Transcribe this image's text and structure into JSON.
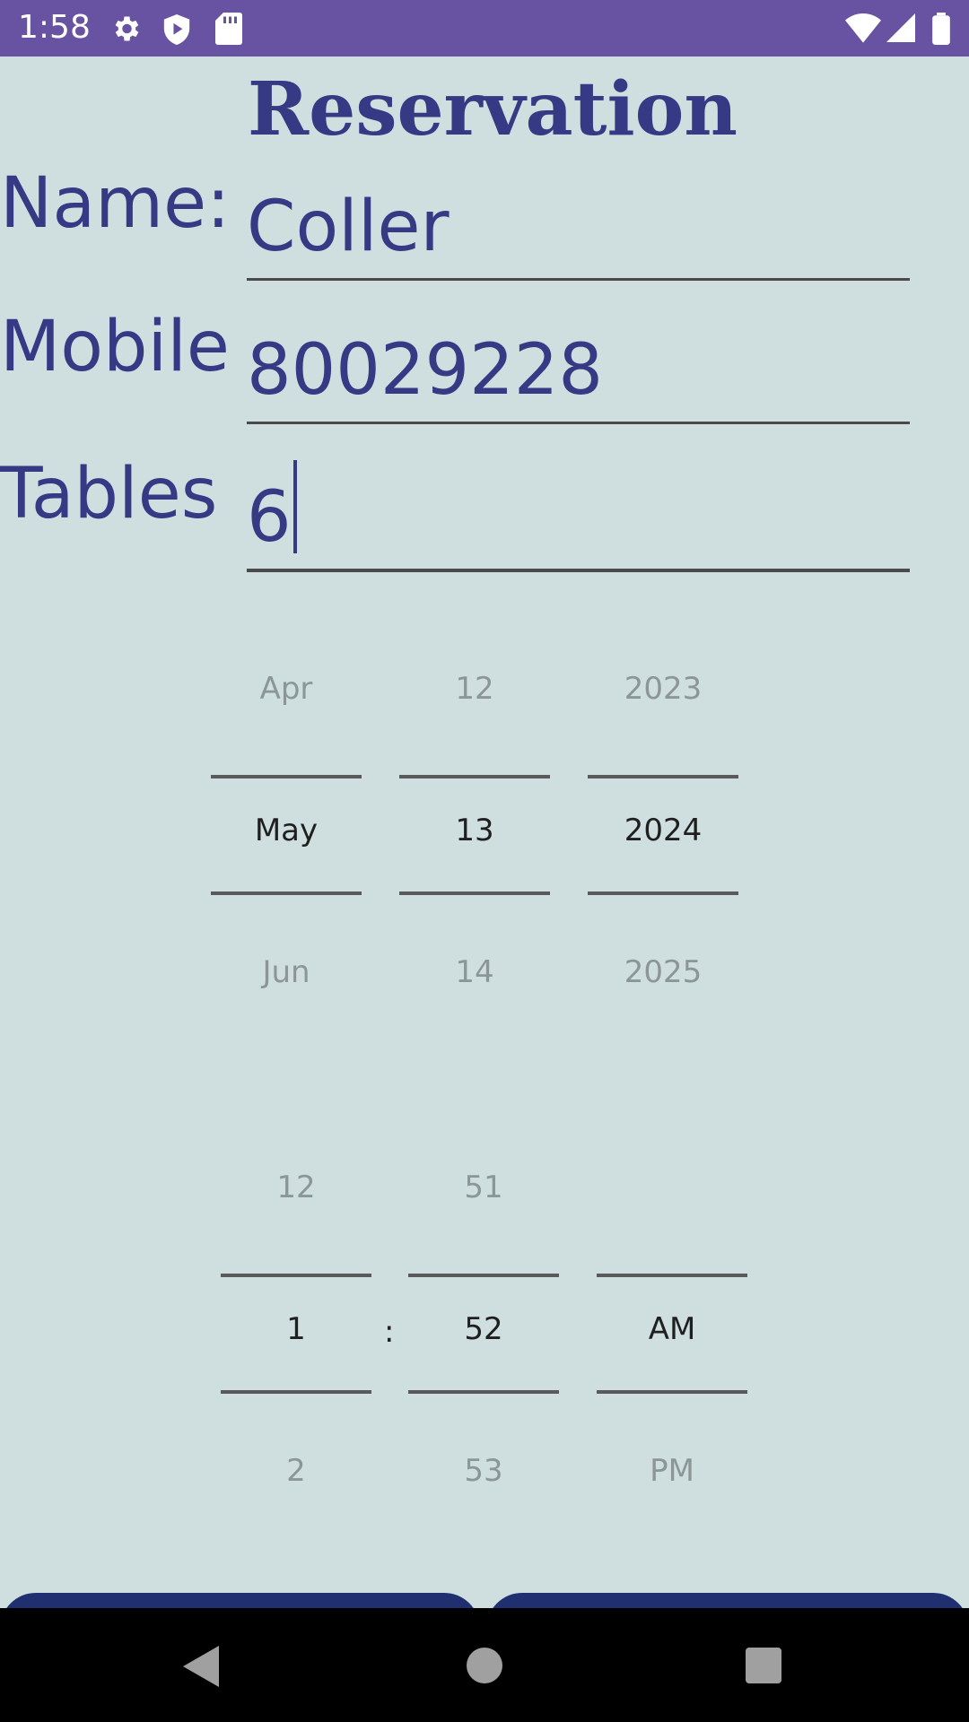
{
  "status_bar": {
    "time": "1:58",
    "icons": [
      "settings-icon",
      "shield-play-icon",
      "sd-card-icon",
      "wifi-icon",
      "signal-icon",
      "battery-icon"
    ]
  },
  "title": "Reservation",
  "form": {
    "name_label": "Name:",
    "name_value": "Coller",
    "mobile_label": "Mobile",
    "mobile_value": "80029228",
    "tables_label": "Tables",
    "tables_value": "6"
  },
  "date_picker": {
    "month": {
      "prev": "Apr",
      "selected": "May",
      "next": "Jun"
    },
    "day": {
      "prev": "12",
      "selected": "13",
      "next": "14"
    },
    "year": {
      "prev": "2023",
      "selected": "2024",
      "next": "2025"
    }
  },
  "time_picker": {
    "hour": {
      "prev": "12",
      "selected": "1",
      "next": "2"
    },
    "separator": ":",
    "minute": {
      "prev": "51",
      "selected": "52",
      "next": "53"
    },
    "ampm": {
      "prev": "",
      "selected": "AM",
      "next": "PM"
    }
  },
  "nav_bar": {
    "icons": [
      "back-icon",
      "home-icon",
      "recents-icon"
    ]
  },
  "colors": {
    "status_bar": "#6852a2",
    "background": "#cfdfdf",
    "accent_text": "#363a84",
    "button": "#1f2f70"
  }
}
